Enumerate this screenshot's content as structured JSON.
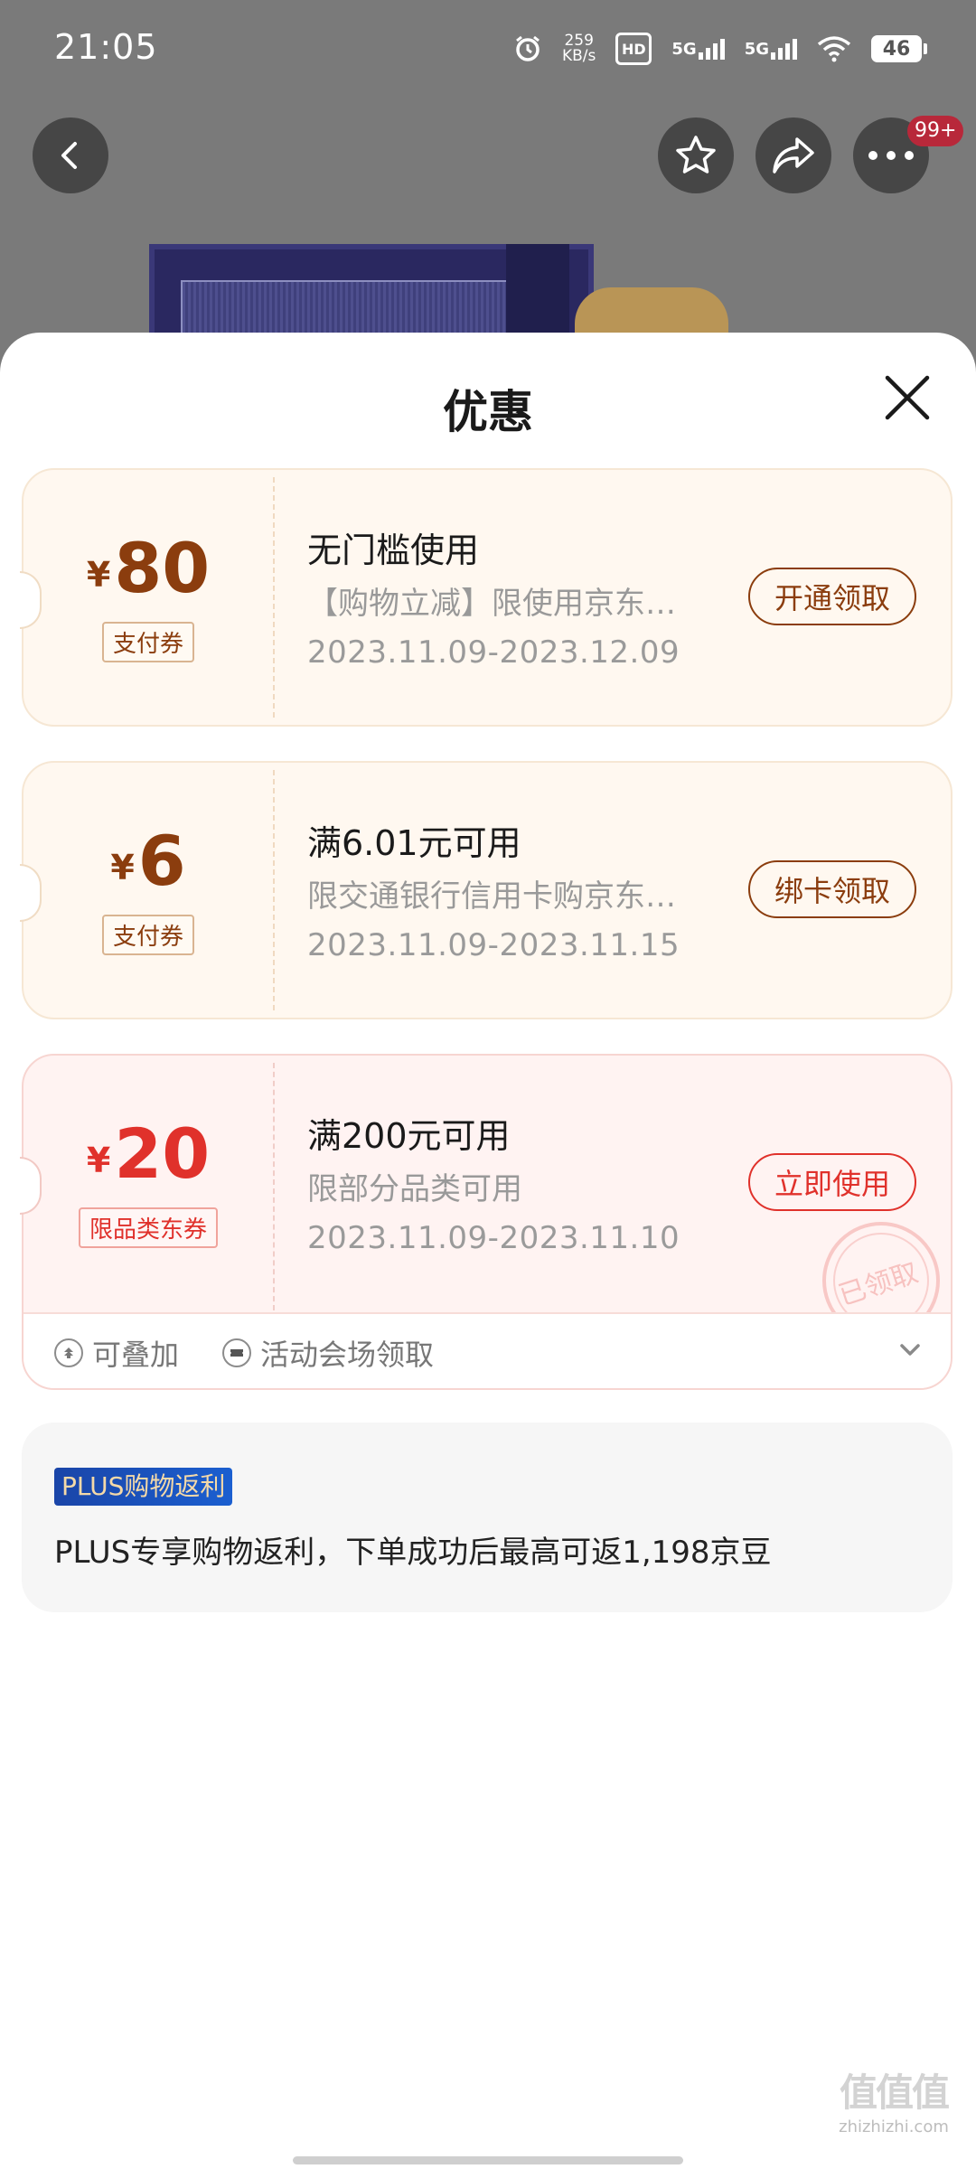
{
  "status_bar": {
    "time": "21:05",
    "net_speed_value": "259",
    "net_speed_unit": "KB/s",
    "hd_label": "HD",
    "sim1_label": "5G",
    "sim2_label": "5G",
    "battery": "46"
  },
  "product_nav": {
    "badge": "99+"
  },
  "sheet": {
    "title": "优惠"
  },
  "coupons": [
    {
      "currency": "¥",
      "amount": "80",
      "tag": "支付券",
      "title": "无门槛使用",
      "desc": "【购物立减】限使用京东…",
      "date": "2023.11.09-2023.12.09",
      "button": "开通领取"
    },
    {
      "currency": "¥",
      "amount": "6",
      "tag": "支付券",
      "title": "满6.01元可用",
      "desc": "限交通银行信用卡购京东…",
      "date": "2023.11.09-2023.11.15",
      "button": "绑卡领取"
    },
    {
      "currency": "¥",
      "amount": "20",
      "tag": "限品类东券",
      "title": "满200元可用",
      "desc": "限部分品类可用",
      "date": "2023.11.09-2023.11.10",
      "button": "立即使用",
      "stamp": "已领取",
      "footer_features": [
        "可叠加",
        "活动会场领取"
      ]
    }
  ],
  "plus": {
    "badge": "PLUS购物返利",
    "text": "PLUS专享购物返利，下单成功后最高可返1,198京豆"
  },
  "watermark": {
    "logo": "值值值",
    "url": "zhizhizhi.com"
  },
  "colors": {
    "pay_brown": "#8b3d0e",
    "category_red": "#e0312b",
    "plus_blue": "#1a45a8"
  }
}
